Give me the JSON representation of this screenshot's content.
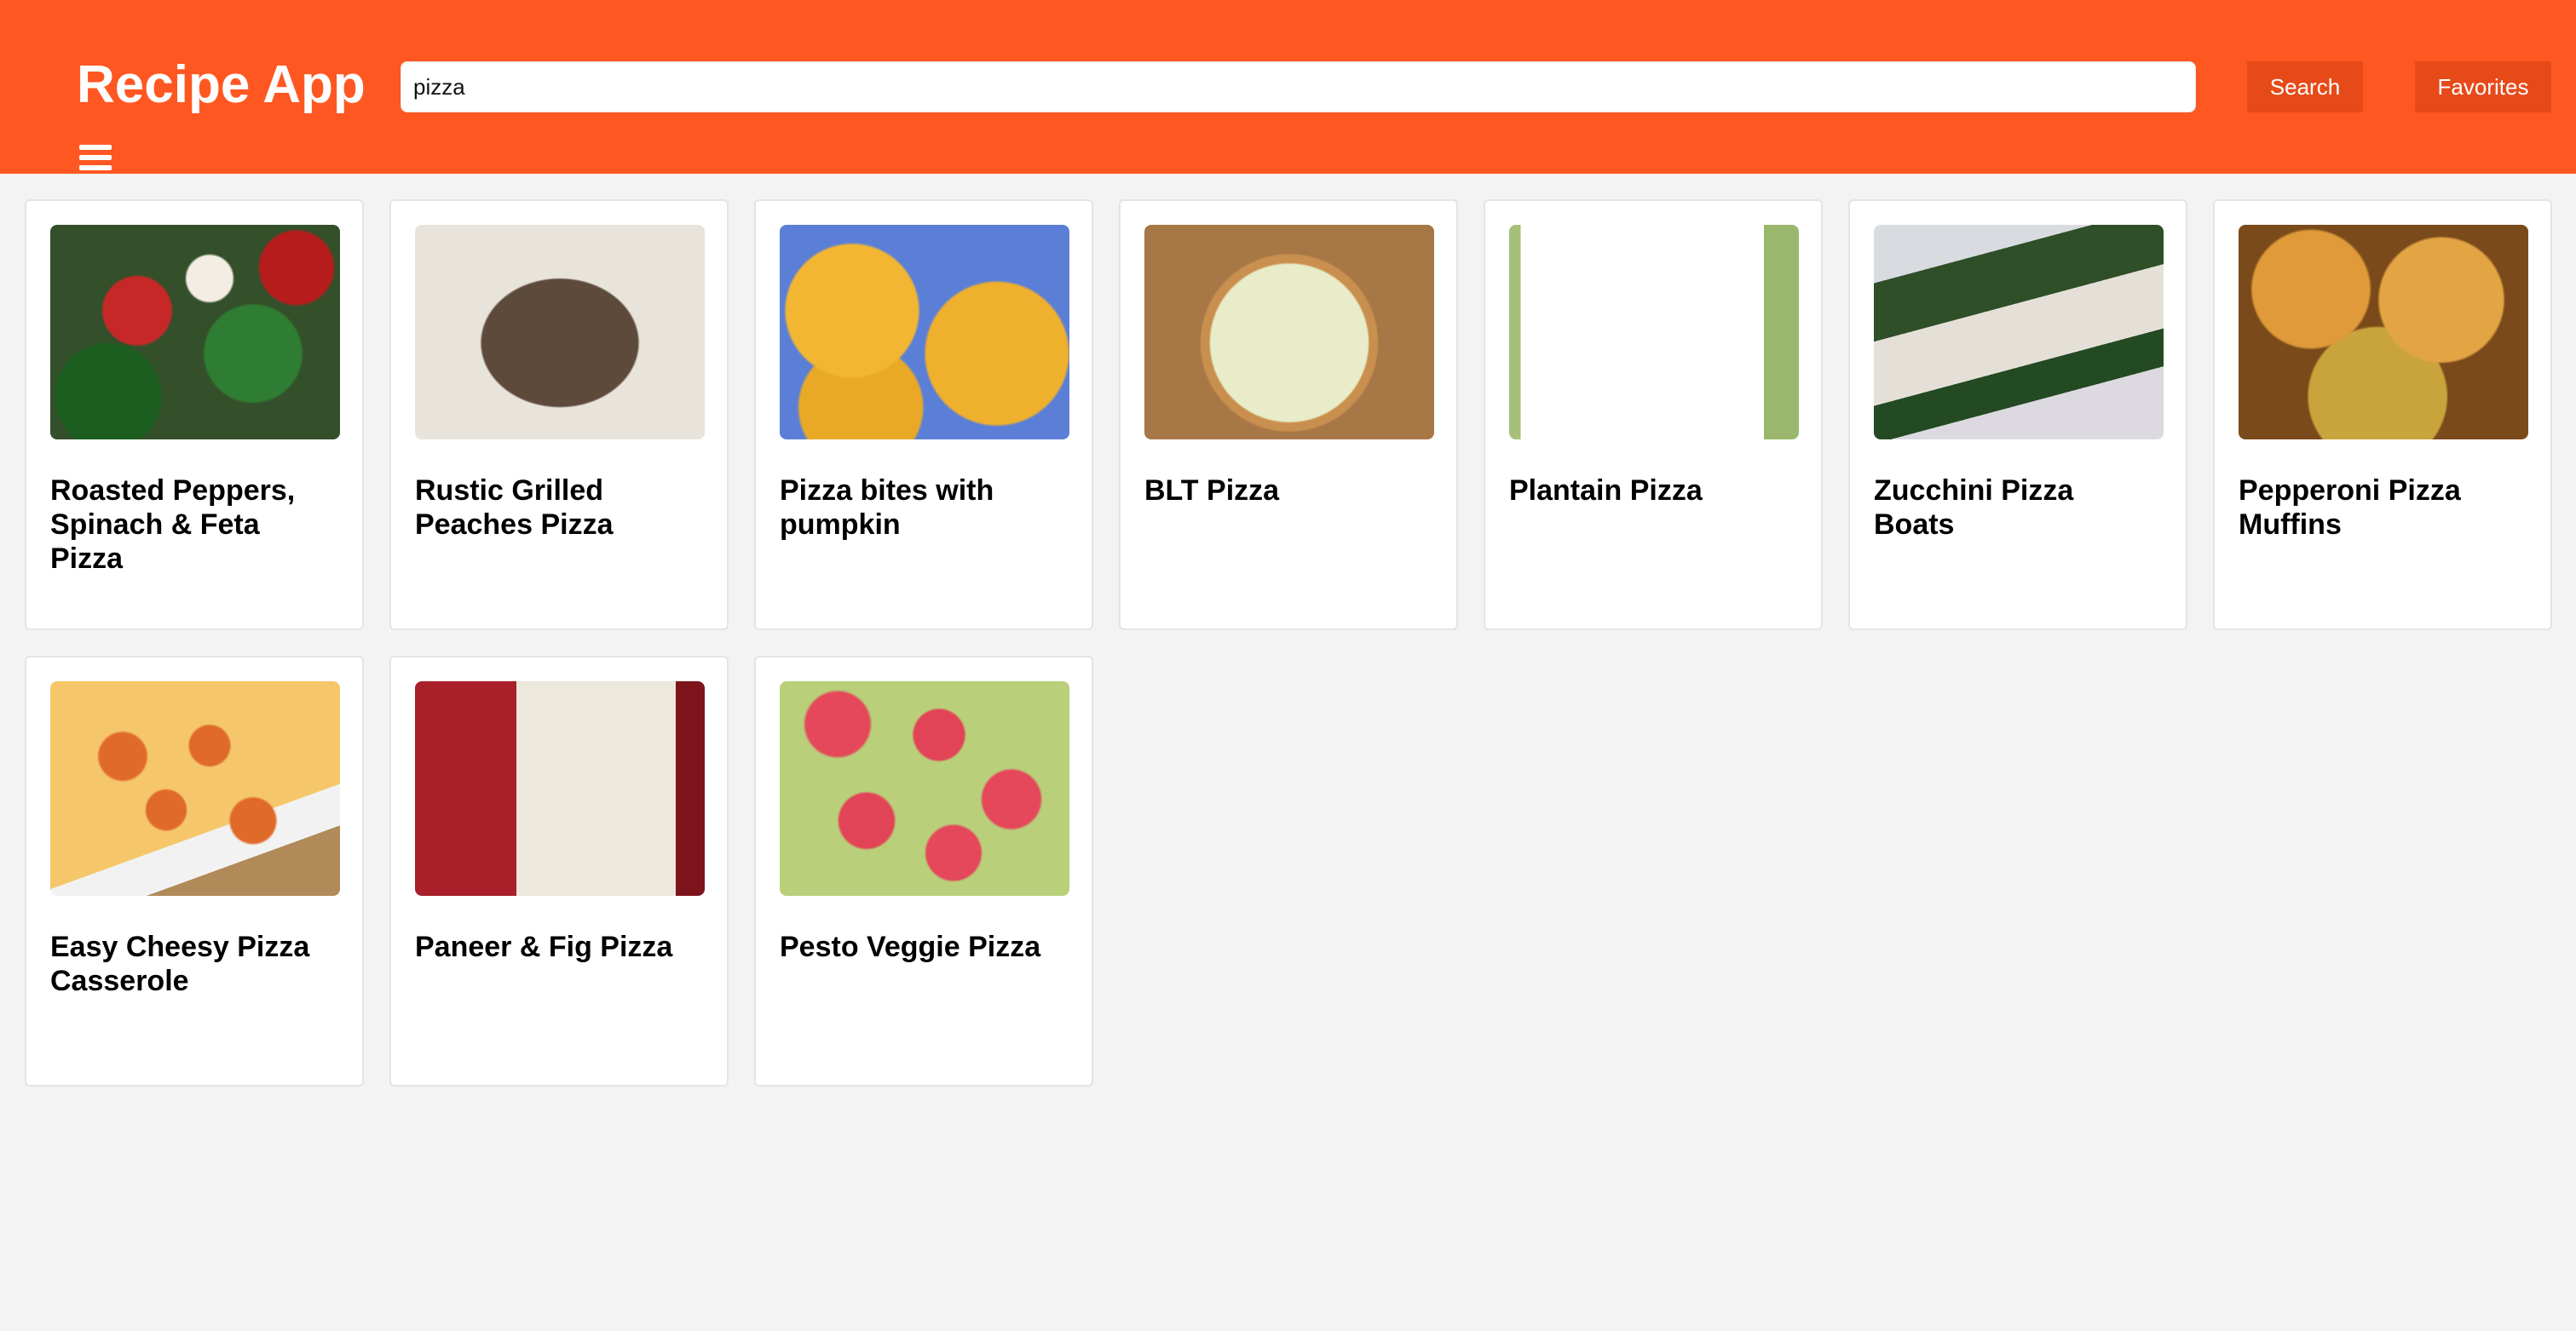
{
  "header": {
    "app_title": "Recipe App",
    "search_value": "pizza",
    "search_button": "Search",
    "favorites_button": "Favorites",
    "menu_icon": "hamburger-menu-icon"
  },
  "colors": {
    "header_bg": "#ff5722",
    "button_bg": "#e64a19",
    "page_bg": "#f3f3f3"
  },
  "recipes": [
    {
      "title": "Roasted Peppers, Spinach & Feta Pizza"
    },
    {
      "title": "Rustic Grilled Peaches Pizza"
    },
    {
      "title": "Pizza bites with pumpkin"
    },
    {
      "title": "BLT Pizza"
    },
    {
      "title": "Plantain Pizza"
    },
    {
      "title": "Zucchini Pizza Boats"
    },
    {
      "title": "Pepperoni Pizza Muffins"
    },
    {
      "title": "Easy Cheesy Pizza Casserole"
    },
    {
      "title": "Paneer & Fig Pizza"
    },
    {
      "title": "Pesto Veggie Pizza"
    }
  ]
}
